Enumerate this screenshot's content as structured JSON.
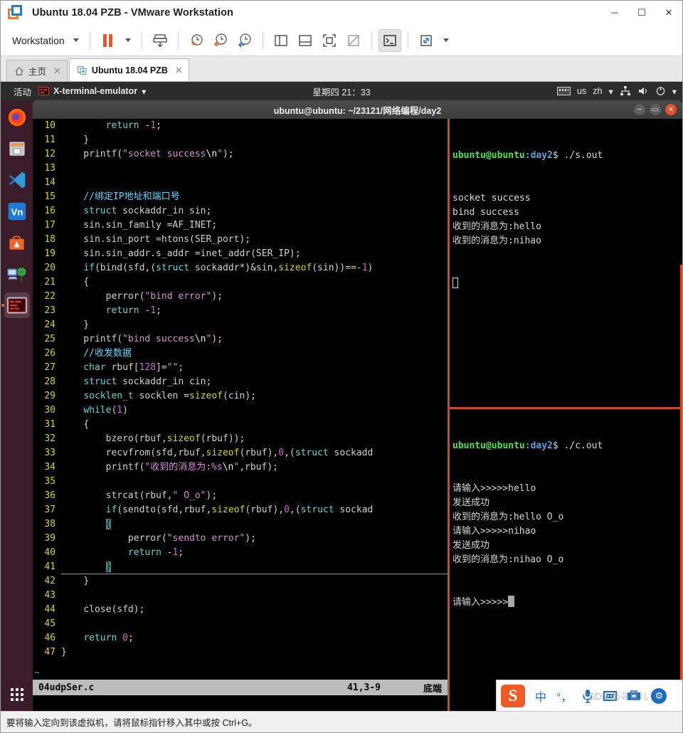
{
  "window": {
    "title": "Ubuntu 18.04 PZB - VMware Workstation",
    "minimize_label": "─",
    "maximize_label": "☐",
    "close_label": "✕"
  },
  "toolbar": {
    "workstation_label": "Workstation",
    "icons": [
      "pause-icon",
      "pause-dropdown-icon",
      "send-ctrl-alt-del-icon",
      "take-snapshot-icon",
      "revert-snapshot-icon",
      "snapshot-manager-icon",
      "show-sidebar-icon",
      "show-thumbnail-bar-icon",
      "full-screen-icon",
      "unity-mode-icon",
      "console-view-icon",
      "stretch-guest-icon",
      "view-dropdown-icon"
    ]
  },
  "tabs": [
    {
      "label": "主页",
      "icon": "home-icon",
      "active": false,
      "close": "✕"
    },
    {
      "label": "Ubuntu 18.04 PZB",
      "icon": "vm-running-icon",
      "active": true,
      "close": "✕"
    }
  ],
  "guest": {
    "panel": {
      "activities": "活动",
      "app_name": "X-terminal-emulator",
      "app_menu_caret": "▾",
      "clock": "星期四 21：33",
      "keyboard_layout": "us",
      "input_method": "zh",
      "input_method_caret": "▾",
      "network_icon": "network-icon",
      "volume_icon": "volume-icon",
      "power_icon": "power-icon",
      "system_caret": "▾"
    },
    "dock": [
      {
        "name": "firefox",
        "label": "Firefox"
      },
      {
        "name": "files",
        "label": "Files"
      },
      {
        "name": "vscode",
        "label": "Visual Studio Code"
      },
      {
        "name": "vnc-viewer",
        "label": "VNC Viewer"
      },
      {
        "name": "ubuntu-software",
        "label": "Ubuntu Software"
      },
      {
        "name": "network-tool",
        "label": "Network Tool"
      },
      {
        "name": "terminal",
        "label": "X-terminal-emulator",
        "running": true
      }
    ],
    "show_apps_label": "Show Applications",
    "terminal_window": {
      "title": "ubuntu@ubuntu: ~/23121/网络编程/day2",
      "minimize": "−",
      "maximize": "▭",
      "close": "✕"
    }
  },
  "vim": {
    "filename": "04udpSer.c",
    "position": "41,3-9",
    "scroll_state": "底端",
    "tilde": "~",
    "lines": [
      {
        "n": "10",
        "text": "        return -1;"
      },
      {
        "n": "11",
        "text": "    }"
      },
      {
        "n": "12",
        "text": "    printf(\"socket success\\n\");"
      },
      {
        "n": "13",
        "text": ""
      },
      {
        "n": "14",
        "text": ""
      },
      {
        "n": "15",
        "text": "    //绑定IP地址和端口号"
      },
      {
        "n": "16",
        "text": "    struct sockaddr_in sin;"
      },
      {
        "n": "17",
        "text": "    sin.sin_family =AF_INET;"
      },
      {
        "n": "18",
        "text": "    sin.sin_port =htons(SER_port);"
      },
      {
        "n": "19",
        "text": "    sin.sin_addr.s_addr =inet_addr(SER_IP);"
      },
      {
        "n": "20",
        "text": "    if(bind(sfd,(struct sockaddr*)&sin,sizeof(sin))==-1)"
      },
      {
        "n": "21",
        "text": "    {"
      },
      {
        "n": "22",
        "text": "        perror(\"bind error\");"
      },
      {
        "n": "23",
        "text": "        return -1;"
      },
      {
        "n": "24",
        "text": "    }"
      },
      {
        "n": "25",
        "text": "    printf(\"bind success\\n\");"
      },
      {
        "n": "26",
        "text": "    //收发数据"
      },
      {
        "n": "27",
        "text": "    char rbuf[128]=\"\";"
      },
      {
        "n": "28",
        "text": "    struct sockaddr_in cin;"
      },
      {
        "n": "29",
        "text": "    socklen_t socklen =sizeof(cin);"
      },
      {
        "n": "30",
        "text": "    while(1)"
      },
      {
        "n": "31",
        "text": "    {"
      },
      {
        "n": "32",
        "text": "        bzero(rbuf,sizeof(rbuf));"
      },
      {
        "n": "33",
        "text": "        recvfrom(sfd,rbuf,sizeof(rbuf),0,(struct sockadd"
      },
      {
        "n": "34",
        "text": "        printf(\"收到的消息为:%s\\n\",rbuf);"
      },
      {
        "n": "35",
        "text": ""
      },
      {
        "n": "36",
        "text": "        strcat(rbuf,\" O_o\");"
      },
      {
        "n": "37",
        "text": "        if(sendto(sfd,rbuf,sizeof(rbuf),0,(struct sockad"
      },
      {
        "n": "38",
        "text": "        {"
      },
      {
        "n": "39",
        "text": "            perror(\"sendto error\");"
      },
      {
        "n": "40",
        "text": "            return -1;"
      },
      {
        "n": "41",
        "text": "        }"
      },
      {
        "n": "42",
        "text": "    }"
      },
      {
        "n": "43",
        "text": ""
      },
      {
        "n": "44",
        "text": "    close(sfd);"
      },
      {
        "n": "45",
        "text": ""
      },
      {
        "n": "46",
        "text": "    return 0;"
      },
      {
        "n": "47",
        "text": "}"
      }
    ]
  },
  "tty_top": {
    "prompt_user": "ubuntu@ubuntu",
    "prompt_path": ":day2",
    "prompt_sym": "$ ",
    "command": "./s.out",
    "output": [
      "socket success",
      "bind success",
      "收到的消息为:hello",
      "收到的消息为:nihao"
    ]
  },
  "tty_bottom": {
    "prompt_user": "ubuntu@ubuntu",
    "prompt_path": ":day2",
    "prompt_sym": "$ ",
    "command": "./c.out",
    "output": [
      "请输入>>>>>hello",
      "发送成功",
      "收到的消息为:hello O_o",
      "请输入>>>>>nihao",
      "发送成功",
      "收到的消息为:nihao O_o"
    ],
    "input_prompt": "请输入>>>>>"
  },
  "ime": {
    "logo": "S",
    "mode": "中",
    "punctuation": "°，",
    "voice_icon": "microphone-icon",
    "keyboard_icon": "soft-keyboard-icon",
    "toolbox_icon": "toolbox-icon",
    "settings_icon": "settings-icon",
    "watermark": "CSDN @寻觅儿"
  },
  "statusbar": {
    "hint": "要将输入定向到该虚拟机，请将鼠标指针移入其中或按 Ctrl+G。"
  },
  "colors": {
    "vmware_orange": "#f07d23",
    "vmware_blue": "#1f7fc4",
    "ubuntu_purple": "#2c001e",
    "terminal_border": "#c84b20",
    "prompt_green": "#4ee44e",
    "prompt_blue": "#4ea3e0",
    "ime_orange": "#f15a22"
  }
}
